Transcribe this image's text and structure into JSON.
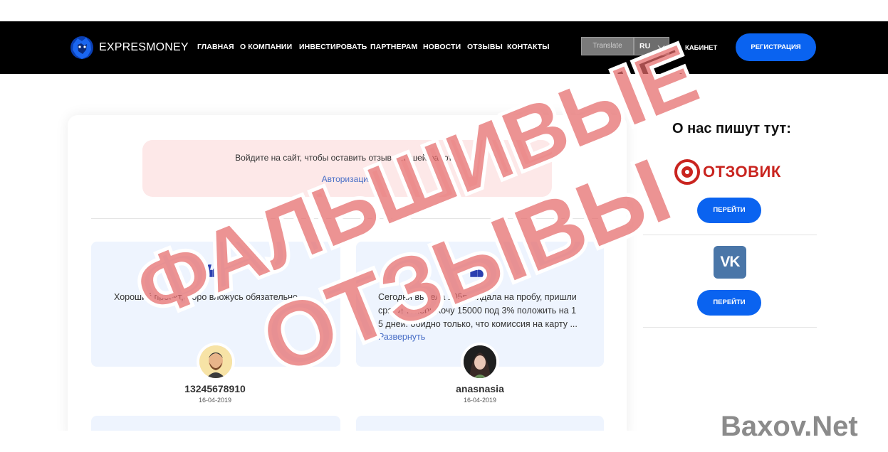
{
  "brand": {
    "name": "EXPRESMONEY"
  },
  "nav": {
    "items": [
      "ГЛАВНАЯ",
      "О КОМПАНИИ",
      "ИНВЕСТИРОВАТЬ",
      "ПАРТНЕРАМ",
      "НОВОСТИ",
      "ОТЗЫВЫ",
      "КОНТАКТЫ"
    ],
    "translate_label": "Translate",
    "language": "RU",
    "cabinet_label": "КАБИНЕТ",
    "register_label": "РЕГИСТРАЦИЯ"
  },
  "login_notice": {
    "text": "Войдите на сайт, чтобы оставить отзыв о нашей работе.",
    "link": "Авторизация"
  },
  "reviews": [
    {
      "text": "Хороший проект,скоро вложусь обязательно",
      "author": "13245678910",
      "date": "16-04-2019"
    },
    {
      "text_lines": [
        "Сегодня вывела 105р. кидала на пробу, пришли",
        "сразу! теперь хочу 15000 под 3% положить на 1",
        "5 дней. обидно только, что комиссия на карту ..."
      ],
      "expand_label": "Развернуть",
      "author": "anasnasia",
      "date": "16-04-2019"
    }
  ],
  "sidebar": {
    "title": "О нас пишут тут:",
    "sites": [
      {
        "name": "ОТЗОВИК",
        "button_label": "ПЕРЕЙТИ"
      },
      {
        "name": "vk",
        "button_label": "ПЕРЕЙТИ"
      }
    ]
  },
  "overlay": {
    "stamp_line1": "ФАЛЬШИВЫЕ",
    "stamp_line2": "ОТЗЫВЫ",
    "watermark": "Baxov.Net"
  },
  "colors": {
    "nav_bg": "#000000",
    "accent_blue": "#0a63f0",
    "notice_bg": "#fde8e8",
    "review_bg": "#eef4fe",
    "stamp_red": "#e05a5a",
    "otzovik_red": "#c9241f",
    "vk_blue": "#4a76a8"
  }
}
